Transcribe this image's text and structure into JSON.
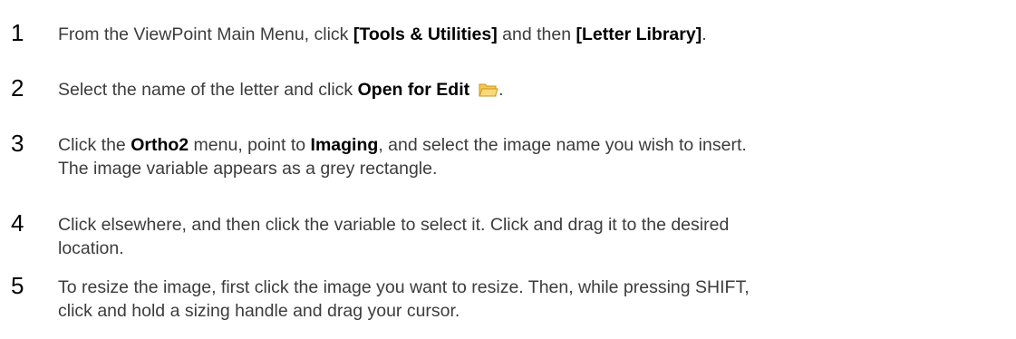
{
  "steps": [
    {
      "number": "1",
      "t1": "From the ViewPoint Main Menu, click ",
      "b1": "[Tools & Utilities]",
      "t2": " and then ",
      "b2": "[Letter Library]",
      "t3": "."
    },
    {
      "number": "2",
      "t1": "Select the name of the letter and click ",
      "b1": "Open for Edit",
      "icon": "folder-open-icon",
      "t2": "."
    },
    {
      "number": "3",
      "t1": "Click the ",
      "b1": "Ortho2",
      "t2": " menu, point to ",
      "b2": "Imaging",
      "t3": ", and select the image name you wish to insert.",
      "line2": "The image variable appears as a grey rectangle."
    },
    {
      "number": "4",
      "t1": "Click elsewhere, and then click the variable to select it. Click and drag it to the desired",
      "line2": "location."
    },
    {
      "number": "5",
      "t1": "To resize the image, first click the image you want to resize. Then, while pressing SHIFT,",
      "line2": "click and hold a sizing handle and drag your cursor."
    }
  ],
  "colors": {
    "number": "#000000",
    "body_text": "#3c3c3c",
    "bold_text": "#000000",
    "folder_fill": "#f6c752",
    "folder_stroke": "#c8961e"
  }
}
